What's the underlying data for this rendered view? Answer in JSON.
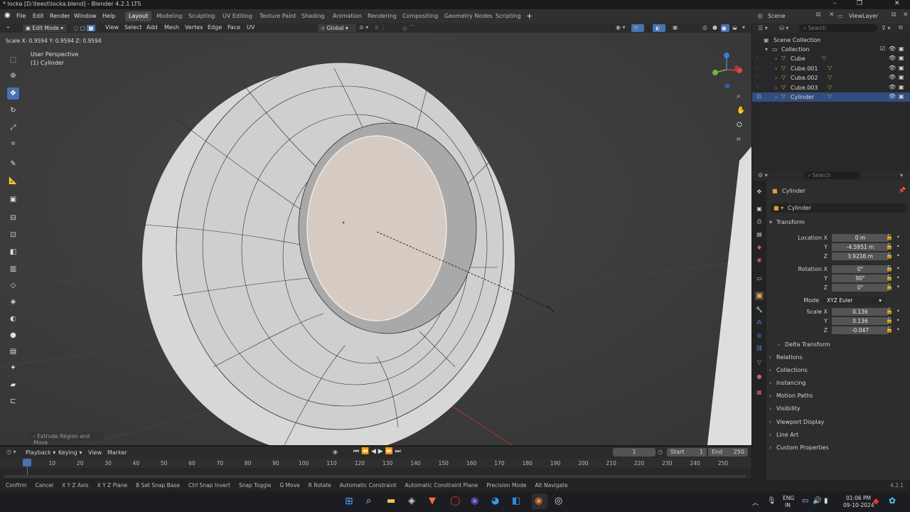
{
  "window": {
    "title": "* locka [D:\\teest\\locka.blend] - Blender 4.2.1 LTS"
  },
  "menu": [
    "File",
    "Edit",
    "Render",
    "Window",
    "Help"
  ],
  "workspaces": [
    "Layout",
    "Modeling",
    "Sculpting",
    "UV Editing",
    "Texture Paint",
    "Shading",
    "Animation",
    "Rendering",
    "Compositing",
    "Geometry Nodes",
    "Scripting"
  ],
  "scene": {
    "label": "Scene",
    "view_layer": "ViewLayer"
  },
  "viewport_header": {
    "mode": "Edit Mode",
    "menus": [
      "View",
      "Select",
      "Add",
      "Mesh",
      "Vertex",
      "Edge",
      "Face",
      "UV"
    ],
    "orientation": "Global"
  },
  "viewport": {
    "operator_readout": "Scale X: 0.9594   Y: 0.9594   Z: 0.9594",
    "view_name": "User Perspective",
    "object_name": "(1) Cylinder",
    "last_operator": "Extrude Region and Move"
  },
  "timeline": {
    "menus": [
      "Playback",
      "Keying",
      "View",
      "Marker"
    ],
    "current_frame": "1",
    "start_label": "Start",
    "start": "1",
    "end_label": "End",
    "end": "250",
    "ticks": [
      "1",
      "10",
      "20",
      "30",
      "40",
      "50",
      "60",
      "70",
      "80",
      "90",
      "100",
      "110",
      "120",
      "130",
      "140",
      "150",
      "160",
      "170",
      "180",
      "190",
      "200",
      "210",
      "220",
      "230",
      "240",
      "250"
    ]
  },
  "outliner": {
    "search_placeholder": "Search",
    "root": "Scene Collection",
    "collection": "Collection",
    "objects": [
      "Cube",
      "Cube.001",
      "Cube.002",
      "Cube.003",
      "Cylinder"
    ],
    "selected": "Cylinder"
  },
  "properties": {
    "search_placeholder": "Search",
    "object": "Cylinder",
    "data_name": "Cylinder",
    "transform": {
      "title": "Transform",
      "location_label": "Location X",
      "location": [
        "0 m",
        "-4.5951 m",
        "3.9216 m"
      ],
      "rotation_label": "Rotation X",
      "rotation": [
        "0°",
        "90°",
        "0°"
      ],
      "mode_label": "Mode",
      "mode": "XYZ Euler",
      "scale_label": "Scale X",
      "scale": [
        "0.136",
        "0.136",
        "-0.047"
      ],
      "axis_y": "Y",
      "axis_z": "Z"
    },
    "panels": [
      "Delta Transform",
      "Relations",
      "Collections",
      "Instancing",
      "Motion Paths",
      "Visibility",
      "Viewport Display",
      "Line Art",
      "Custom Properties"
    ]
  },
  "statusbar": {
    "items": [
      "Confirm",
      "Cancel",
      "X Y Z Axis",
      "X Y Z Plane",
      "B Set Snap Base",
      "Ctrl Snap Invert",
      "Snap Toggle",
      "G Move",
      "R Rotate",
      "Automatic Constraint",
      "Automatic Constraint Plane",
      "Precision Mode",
      "Alt Navigate"
    ],
    "version": "4.2.1"
  },
  "taskbar": {
    "lang": "ENG",
    "region": "IN",
    "time": "01:06 PM",
    "date": "09-10-2024"
  },
  "colors": {
    "accent": "#4772b3",
    "selection": "#334d80",
    "viewport": "#3d3d3d"
  }
}
